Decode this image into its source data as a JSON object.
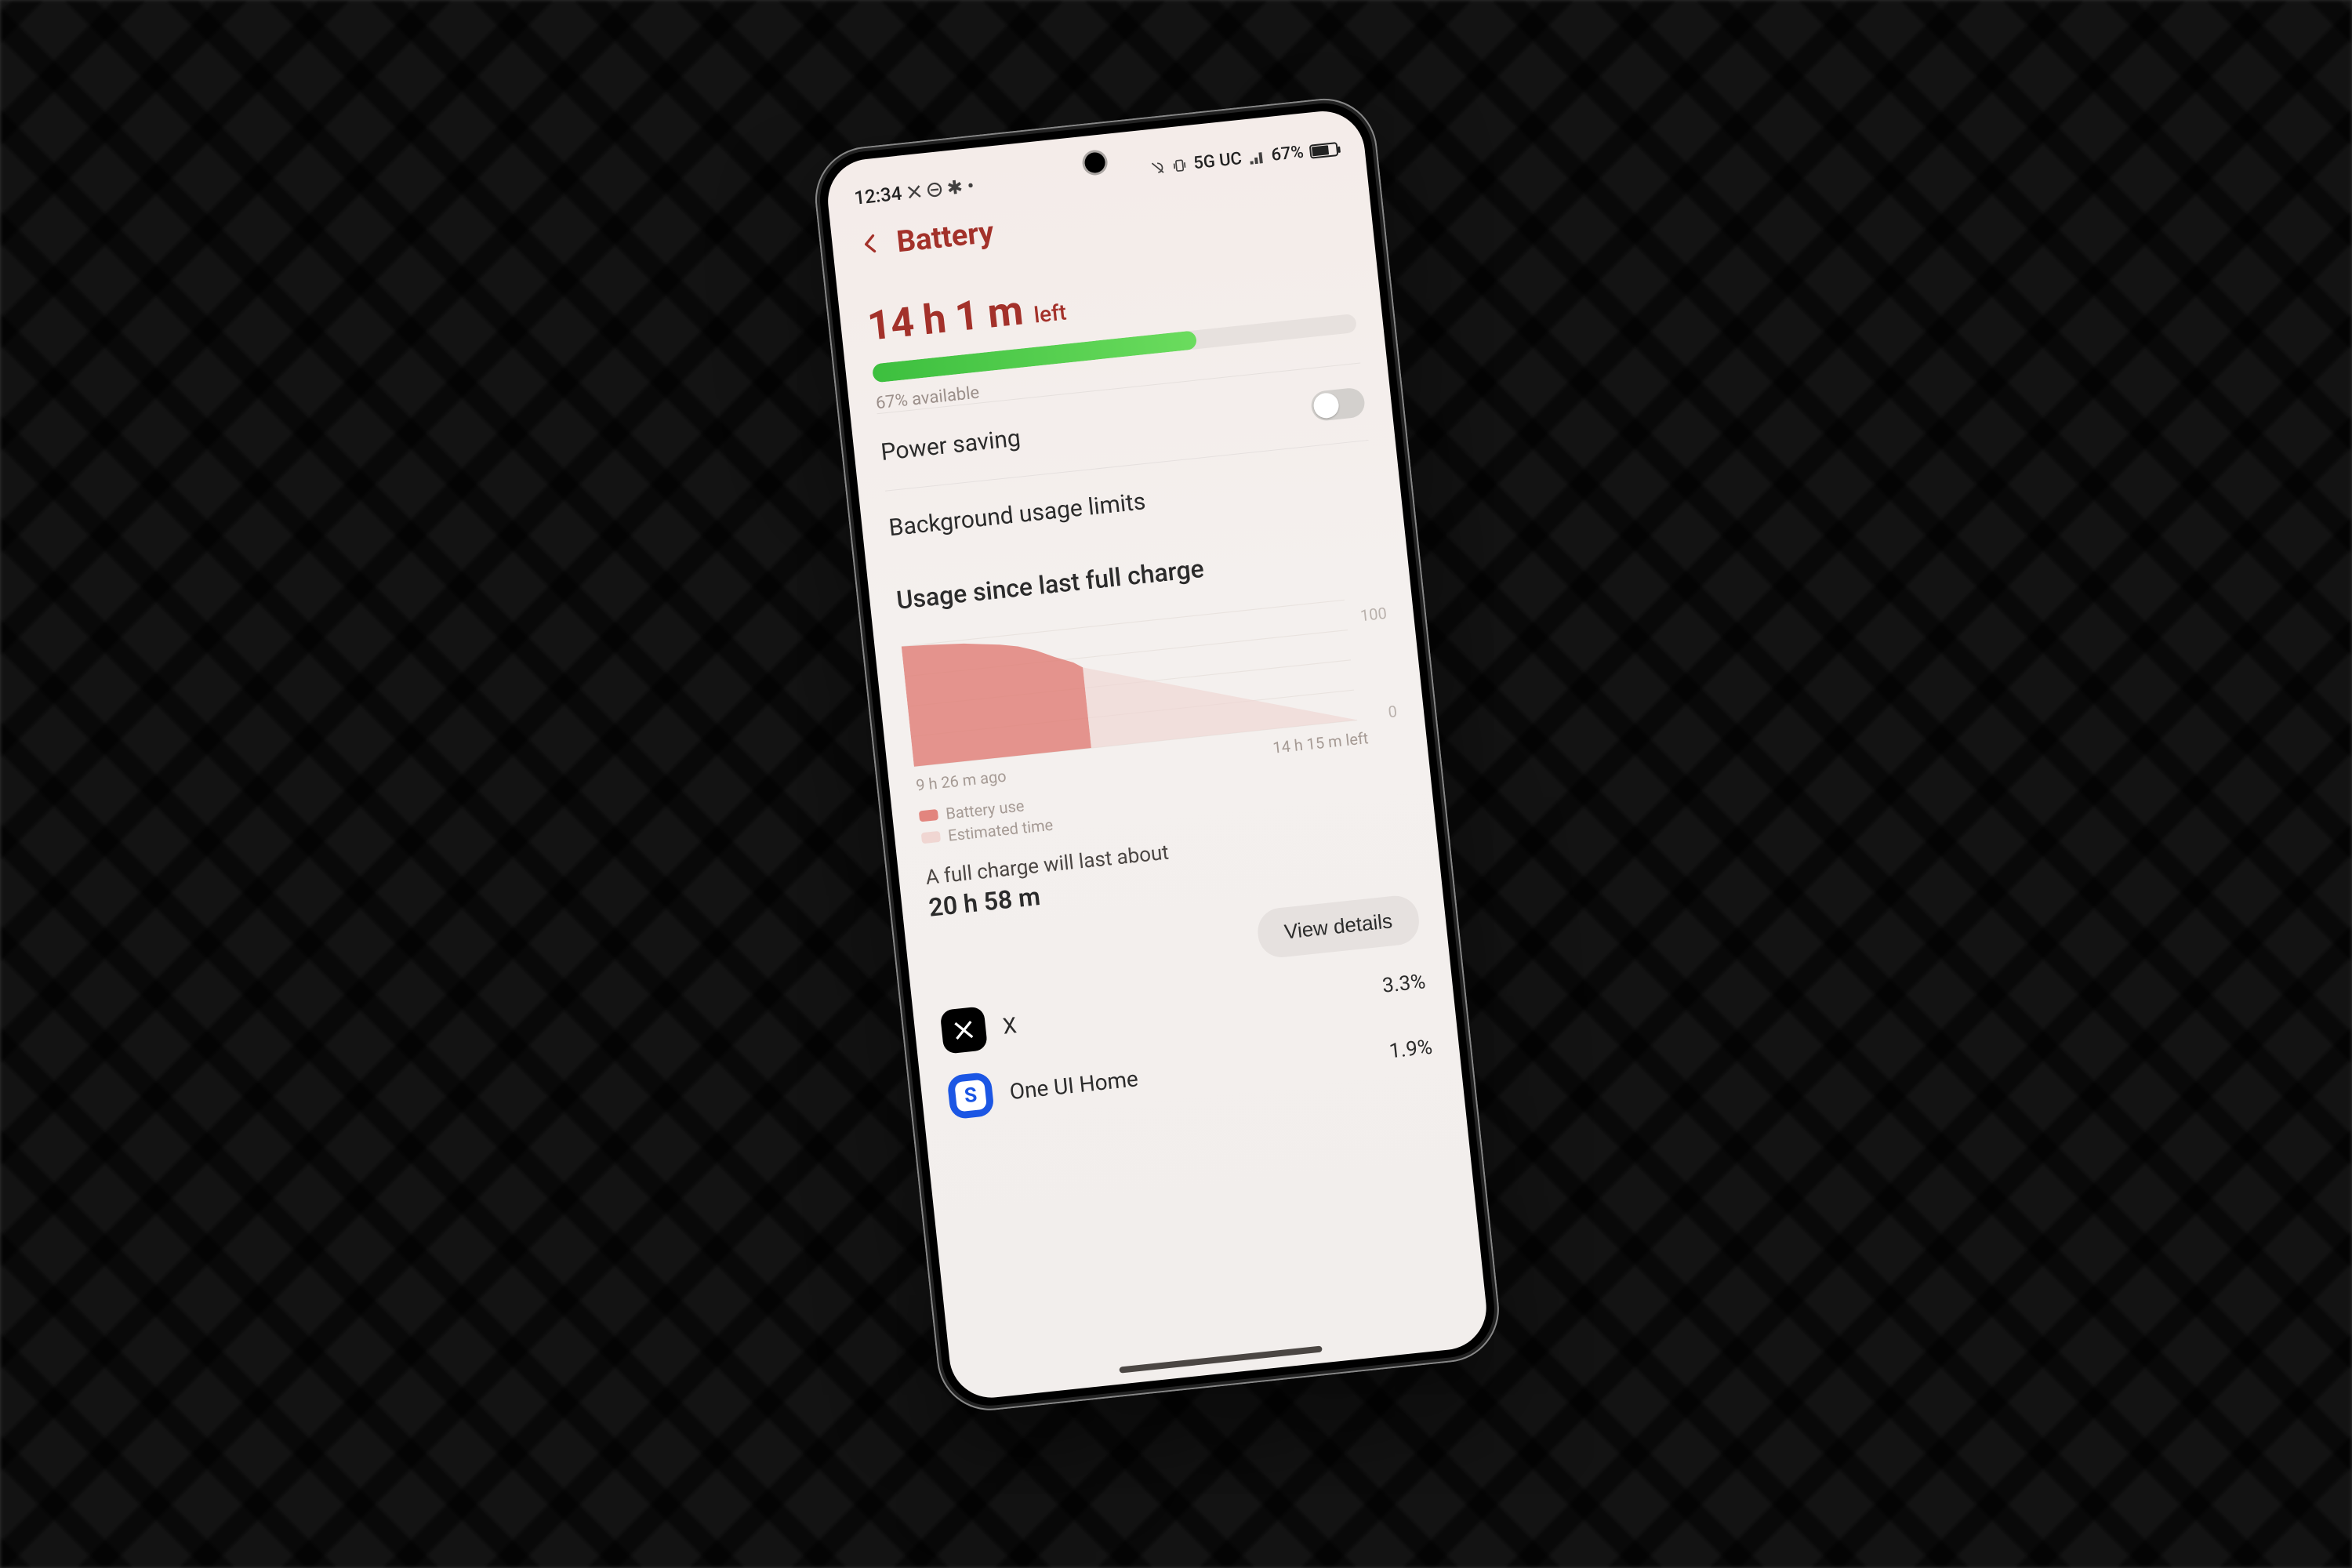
{
  "status": {
    "time": "12:34",
    "network_label": "5G UC",
    "battery_pct_text": "67%"
  },
  "header": {
    "title": "Battery"
  },
  "remaining": {
    "time": "14 h 1 m",
    "suffix": "left",
    "available_text": "67% available",
    "pct": 67
  },
  "rows": {
    "power_saving_label": "Power saving",
    "power_saving_on": false,
    "bg_limits_label": "Background usage limits"
  },
  "usage": {
    "title": "Usage since last full charge",
    "x_left": "9 h 26 m ago",
    "x_right": "14 h 15 m left",
    "y_top": "100",
    "y_bottom": "0",
    "legend_use": "Battery use",
    "legend_est": "Estimated time",
    "full_charge_label": "A full charge will last about",
    "full_charge_time": "20 h 58 m",
    "view_details": "View details"
  },
  "apps": [
    {
      "name": "X",
      "pct": "3.3%"
    },
    {
      "name": "One UI Home",
      "pct": "1.9%"
    }
  ],
  "chart_data": {
    "type": "area",
    "xlabel": "",
    "ylabel": "",
    "ylim": [
      0,
      100
    ],
    "annotations": {
      "x_left": "9 h 26 m ago",
      "x_right": "14 h 15 m left"
    },
    "series": [
      {
        "name": "Battery use",
        "x": [
          0,
          0.06,
          0.1,
          0.14,
          0.18,
          0.22,
          0.26,
          0.3,
          0.34,
          0.38,
          0.4
        ],
        "values": [
          100,
          99,
          98,
          97,
          95,
          93,
          90,
          85,
          78,
          72,
          67
        ]
      },
      {
        "name": "Estimated time",
        "x": [
          0.4,
          1.0
        ],
        "values": [
          67,
          0
        ]
      }
    ]
  }
}
